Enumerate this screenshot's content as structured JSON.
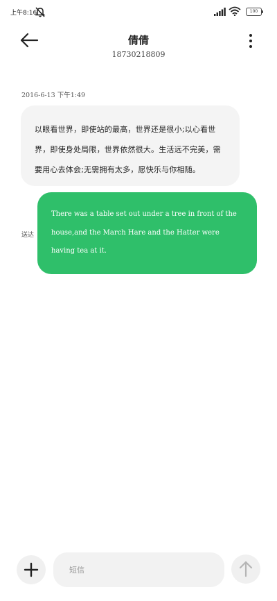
{
  "status_bar": {
    "time": "上午8:16",
    "battery": "100"
  },
  "header": {
    "contact_name": "倩倩",
    "contact_number": "18730218809"
  },
  "conversation": {
    "timestamp": "2016-6-13 下午1:49",
    "incoming_message": "以眼看世界，即使站的最高，世界还是很小;以心看世界，即使身处局限，世界依然很大。生活远不完美，需要用心去体会;无需拥有太多，愿快乐与你相随。",
    "outgoing_message": "There was a table set out under a tree in front of the house,and the March Hare and the Hatter were having tea at it.",
    "outgoing_status": "送达"
  },
  "composer": {
    "placeholder": "短信"
  },
  "icons": {
    "back": "arrow-left-icon",
    "more": "more-vertical-icon",
    "add": "plus-icon",
    "send": "arrow-up-icon",
    "mute": "bell-off-icon",
    "signal": "signal-icon",
    "wifi": "wifi-icon",
    "battery": "battery-icon"
  },
  "colors": {
    "outgoing_bubble": "#2fbf6a",
    "incoming_bubble": "#f4f4f4",
    "input_background": "#f2f2f2"
  }
}
